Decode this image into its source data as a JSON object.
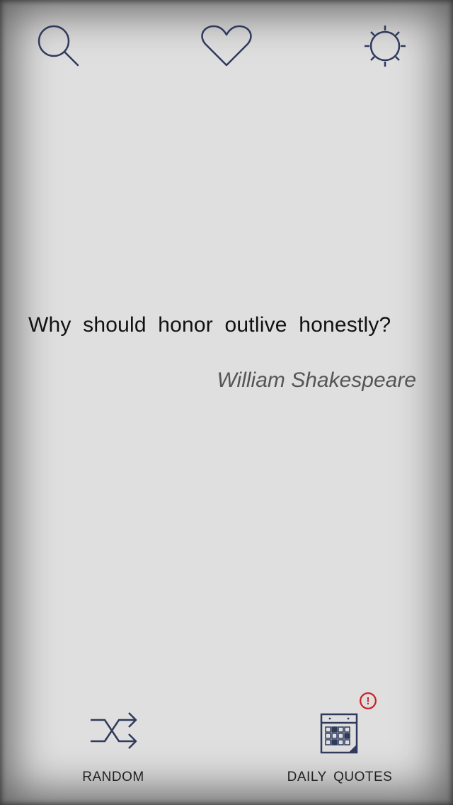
{
  "header": {
    "search_icon": "search-icon",
    "favorites_icon": "heart-icon",
    "settings_icon": "sun-icon"
  },
  "quote": {
    "text": "Why should honor outlive honestly?",
    "author": "William Shakespeare"
  },
  "bottom_bar": {
    "random_label": "RANDOM",
    "daily_label": "DAILY QUOTES",
    "daily_alert": "!"
  },
  "colors": {
    "background": "#dfdfdf",
    "icon_stroke": "#2f3a5c",
    "alert": "#cc2222",
    "quote_text": "#111111",
    "author_text": "#555555"
  }
}
